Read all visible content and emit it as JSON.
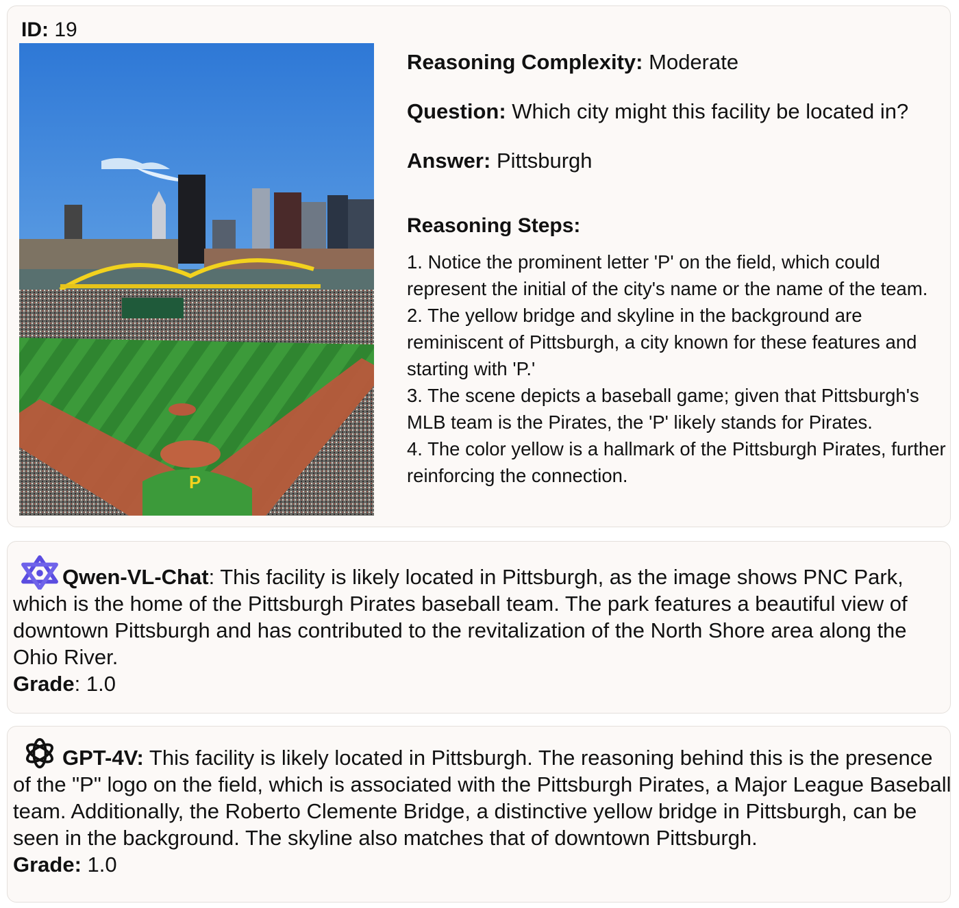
{
  "header": {
    "id_label": "ID:",
    "id_value": "19"
  },
  "meta": {
    "complexity_label": "Reasoning Complexity:",
    "complexity_value": "Moderate",
    "question_label": "Question:",
    "question_value": "Which city might this facility be located in?",
    "answer_label": "Answer:",
    "answer_value": "Pittsburgh"
  },
  "steps": {
    "title": "Reasoning Steps:",
    "items": [
      "1. Notice the prominent letter 'P' on the field, which could represent the initial of the city's name or the name of the team.",
      "2. The yellow bridge and skyline in the background are reminiscent of Pittsburgh, a city known for these features and starting with 'P.'",
      "3. The scene depicts a baseball game; given that Pittsburgh's MLB team is the Pirates, the 'P' likely stands for Pirates.",
      "4. The color yellow is a hallmark of the Pittsburgh Pirates, further reinforcing the connection."
    ]
  },
  "photo": {
    "field_letter": "P"
  },
  "responses": [
    {
      "model": "Qwen-VL-Chat",
      "separator": ":",
      "text": " This facility is likely located in Pittsburgh, as the image shows PNC Park, which is the home of the Pittsburgh Pirates baseball team. The park features a beautiful view of downtown Pittsburgh and has contributed to the revitalization of the North Shore area along the Ohio River.",
      "grade_label": "Grade",
      "grade_sep": ": ",
      "grade_value": "1.0",
      "icon": "qwen-logo-icon",
      "icon_color": "#5b4de0"
    },
    {
      "model": "GPT-4V:",
      "separator": "",
      "text": " This facility is likely located in Pittsburgh. The reasoning behind this is the presence of the \"P\" logo on the field, which is associated with the Pittsburgh Pirates, a Major League Baseball team. Additionally, the Roberto Clemente Bridge, a distinctive yellow bridge in Pittsburgh, can be seen in the background. The skyline also matches that of downtown Pittsburgh.",
      "grade_label": "Grade:",
      "grade_sep": " ",
      "grade_value": "1.0",
      "icon": "openai-logo-icon",
      "icon_color": "#111111"
    }
  ]
}
